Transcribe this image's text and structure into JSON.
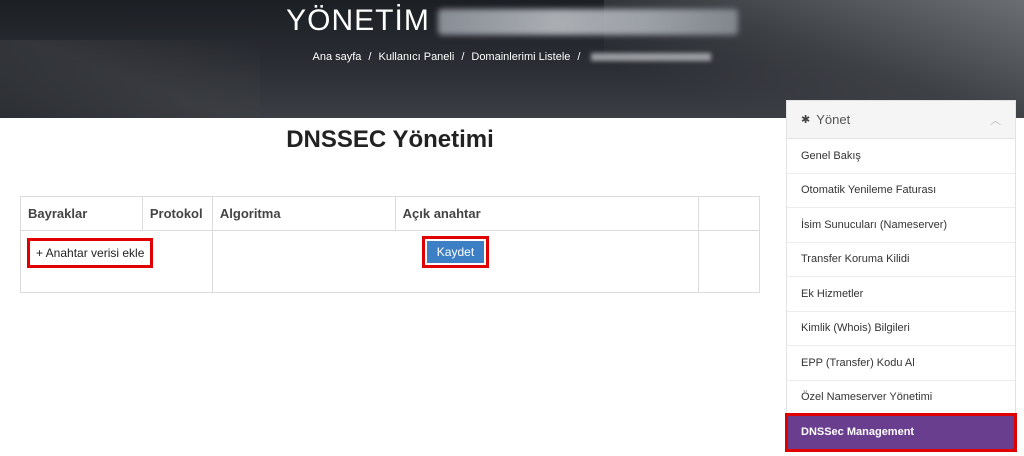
{
  "header": {
    "title": "YÖNETİM",
    "breadcrumb": [
      "Ana sayfa",
      "Kullanıcı Paneli",
      "Domainlerimi Listele"
    ]
  },
  "page": {
    "heading": "DNSSEC Yönetimi"
  },
  "table": {
    "headers": [
      "Bayraklar",
      "Protokol",
      "Algoritma",
      "Açık anahtar",
      ""
    ],
    "add_button": "+ Anahtar verisi ekle",
    "save_button": "Kaydet"
  },
  "sidebar": {
    "title": "Yönet",
    "title_icon": "gear-icon",
    "collapse_icon": "chevron-up-icon",
    "items": [
      {
        "label": "Genel Bakış"
      },
      {
        "label": "Otomatik Yenileme Faturası"
      },
      {
        "label": "İsim Sunucuları (Nameserver)"
      },
      {
        "label": "Transfer Koruma Kilidi"
      },
      {
        "label": "Ek Hizmetler"
      },
      {
        "label": "Kimlik (Whois) Bilgileri"
      },
      {
        "label": "EPP (Transfer) Kodu Al"
      },
      {
        "label": "Özel Nameserver Yönetimi"
      },
      {
        "label": "DNSSec Management"
      }
    ],
    "active_color": "#6a3e8f"
  },
  "colors": {
    "highlight": "#e00000",
    "primary_button": "#3c7fc4"
  }
}
